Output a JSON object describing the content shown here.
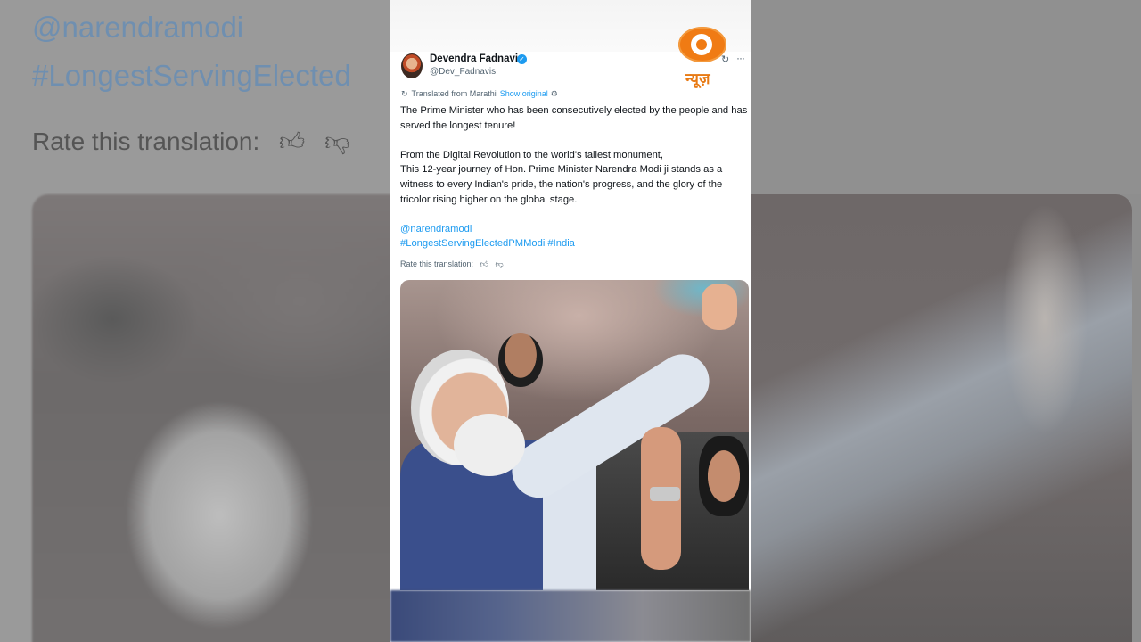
{
  "background": {
    "mirror_mention": "@narendramodi",
    "mirror_hashtag": "#LongestServingElected",
    "mirror_rate_label": "Rate this translation:"
  },
  "channel_logo": {
    "text": "न्यूज़",
    "color": "#e87a14"
  },
  "post": {
    "author_name": "Devendra Fadnavis",
    "author_handle": "@Dev_Fadnavis",
    "verified": true,
    "translated_label": "Translated from Marathi",
    "show_original_label": "Show original",
    "body_line1": "The Prime Minister who has been consecutively elected by the people and has served the longest tenure!",
    "body_line2": "From the Digital Revolution to the world's tallest monument,",
    "body_line3": "This 12-year journey of Hon. Prime Minister Narendra Modi ji stands as a witness to every Indian's pride, the nation's progress, and the glory of the tricolor rising higher on the global stage.",
    "mention": "@narendramodi",
    "hashtags": "#LongestServingElectedPMModi #India",
    "rate_label": "Rate this translation:",
    "link_color": "#1d9bf0"
  }
}
